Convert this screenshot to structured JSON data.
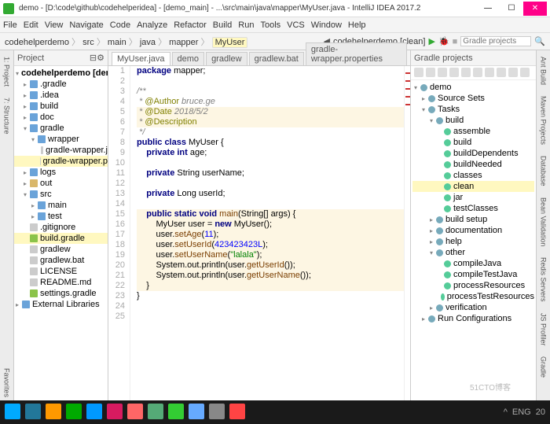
{
  "window": {
    "title": "demo - [D:\\code\\github\\codehelperidea] - [demo_main] - ...\\src\\main\\java\\mapper\\MyUser.java - IntelliJ IDEA 2017.2",
    "min": "—",
    "max": "☐",
    "close": "✕"
  },
  "menu": [
    "File",
    "Edit",
    "View",
    "Navigate",
    "Code",
    "Analyze",
    "Refactor",
    "Build",
    "Run",
    "Tools",
    "VCS",
    "Window",
    "Help"
  ],
  "breadcrumbs": [
    "codehelperdemo",
    "src",
    "main",
    "java",
    "mapper",
    "MyUser"
  ],
  "runconfig": "codehelperdemo [clean]",
  "search": "Gradle projects",
  "project": {
    "header": "Project",
    "nodes": [
      {
        "pad": 0,
        "tw": "▾",
        "ic": "folder",
        "label": "codehelperdemo [demo]",
        "bold": true
      },
      {
        "pad": 10,
        "tw": "▸",
        "ic": "folder",
        "label": ".gradle"
      },
      {
        "pad": 10,
        "tw": "▸",
        "ic": "folder",
        "label": ".idea"
      },
      {
        "pad": 10,
        "tw": "▸",
        "ic": "folder",
        "label": "build"
      },
      {
        "pad": 10,
        "tw": "▸",
        "ic": "folder",
        "label": "doc"
      },
      {
        "pad": 10,
        "tw": "▾",
        "ic": "folder",
        "label": "gradle"
      },
      {
        "pad": 20,
        "tw": "▾",
        "ic": "folder",
        "label": "wrapper"
      },
      {
        "pad": 30,
        "tw": "",
        "ic": "file",
        "label": "gradle-wrapper.j"
      },
      {
        "pad": 30,
        "tw": "",
        "ic": "file",
        "label": "gradle-wrapper.p",
        "sel": true
      },
      {
        "pad": 10,
        "tw": "▸",
        "ic": "folder",
        "label": "logs"
      },
      {
        "pad": 10,
        "tw": "▸",
        "ic": "folder-o",
        "label": "out"
      },
      {
        "pad": 10,
        "tw": "▾",
        "ic": "folder",
        "label": "src"
      },
      {
        "pad": 20,
        "tw": "▸",
        "ic": "folder",
        "label": "main"
      },
      {
        "pad": 20,
        "tw": "▸",
        "ic": "folder",
        "label": "test"
      },
      {
        "pad": 10,
        "tw": "",
        "ic": "file",
        "label": ".gitignore"
      },
      {
        "pad": 10,
        "tw": "",
        "ic": "file-g",
        "label": "build.gradle",
        "sel": true
      },
      {
        "pad": 10,
        "tw": "",
        "ic": "file",
        "label": "gradlew"
      },
      {
        "pad": 10,
        "tw": "",
        "ic": "file",
        "label": "gradlew.bat"
      },
      {
        "pad": 10,
        "tw": "",
        "ic": "file",
        "label": "LICENSE"
      },
      {
        "pad": 10,
        "tw": "",
        "ic": "file",
        "label": "README.md"
      },
      {
        "pad": 10,
        "tw": "",
        "ic": "file-g",
        "label": "settings.gradle"
      },
      {
        "pad": 0,
        "tw": "▸",
        "ic": "folder",
        "label": "External Libraries"
      }
    ]
  },
  "tabs": [
    {
      "label": "MyUser.java",
      "active": true
    },
    {
      "label": "demo"
    },
    {
      "label": "gradlew"
    },
    {
      "label": "gradlew.bat"
    },
    {
      "label": "gradle-wrapper.properties"
    }
  ],
  "code": {
    "start": 1,
    "raw": [
      {
        "t": "<span class='kw'>package</span> mapper;"
      },
      {
        "t": ""
      },
      {
        "t": "<span class='cmt'>/**</span>"
      },
      {
        "t": "<span class='cmt'> * </span><span class='ann'>@Author</span> <span class='cmt'>bruce.ge</span>"
      },
      {
        "t": "<span class='cmt'> * </span><span class='ann'>@Date</span> <span class='cmt'>2018/5/2</span>",
        "hl": true
      },
      {
        "t": "<span class='cmt'> * </span><span class='ann'>@Description</span>",
        "hl": true
      },
      {
        "t": "<span class='cmt'> */</span>"
      },
      {
        "t": "<span class='kw'>public class</span> MyUser {"
      },
      {
        "t": "    <span class='kw'>private int</span> age;"
      },
      {
        "t": ""
      },
      {
        "t": "    <span class='kw'>private</span> String userName;"
      },
      {
        "t": ""
      },
      {
        "t": "    <span class='kw'>private</span> Long userId;"
      },
      {
        "t": ""
      },
      {
        "t": "    <span class='kw'>public static void</span> <span class='mth'>main</span>(String[] args) {",
        "hl": true
      },
      {
        "t": "        MyUser user = <span class='kw'>new</span> MyUser();",
        "hl": true
      },
      {
        "t": "        user.<span class='mth'>setAge</span>(<span class='num'>11</span>);",
        "hl": true
      },
      {
        "t": "        user.<span class='mth'>setUserId</span>(<span class='num'>423423423L</span>);",
        "hl": true
      },
      {
        "t": "        user.<span class='mth'>setUserName</span>(<span class='str'>\"lalala\"</span>);",
        "hl": true
      },
      {
        "t": "        System.out.println(user.<span class='mth'>getUserId</span>());",
        "hl": true
      },
      {
        "t": "        System.out.println(user.<span class='mth'>getUserName</span>());",
        "hl": true
      },
      {
        "t": "    }",
        "hl": true
      },
      {
        "t": "}"
      },
      {
        "t": ""
      },
      {
        "t": ""
      }
    ]
  },
  "gradle": {
    "header": "Gradle projects",
    "nodes": [
      {
        "pad": 0,
        "tw": "▾",
        "ic": "grp",
        "label": "demo"
      },
      {
        "pad": 10,
        "tw": "▸",
        "ic": "grp",
        "label": "Source Sets"
      },
      {
        "pad": 10,
        "tw": "▾",
        "ic": "grp",
        "label": "Tasks"
      },
      {
        "pad": 20,
        "tw": "▾",
        "ic": "grp",
        "label": "build"
      },
      {
        "pad": 30,
        "tw": "",
        "ic": "task",
        "label": "assemble"
      },
      {
        "pad": 30,
        "tw": "",
        "ic": "task",
        "label": "build"
      },
      {
        "pad": 30,
        "tw": "",
        "ic": "task",
        "label": "buildDependents"
      },
      {
        "pad": 30,
        "tw": "",
        "ic": "task",
        "label": "buildNeeded"
      },
      {
        "pad": 30,
        "tw": "",
        "ic": "task",
        "label": "classes"
      },
      {
        "pad": 30,
        "tw": "",
        "ic": "task",
        "label": "clean",
        "sel": true
      },
      {
        "pad": 30,
        "tw": "",
        "ic": "task",
        "label": "jar"
      },
      {
        "pad": 30,
        "tw": "",
        "ic": "task",
        "label": "testClasses"
      },
      {
        "pad": 20,
        "tw": "▸",
        "ic": "grp",
        "label": "build setup"
      },
      {
        "pad": 20,
        "tw": "▸",
        "ic": "grp",
        "label": "documentation"
      },
      {
        "pad": 20,
        "tw": "▸",
        "ic": "grp",
        "label": "help"
      },
      {
        "pad": 20,
        "tw": "▾",
        "ic": "grp",
        "label": "other"
      },
      {
        "pad": 30,
        "tw": "",
        "ic": "task",
        "label": "compileJava"
      },
      {
        "pad": 30,
        "tw": "",
        "ic": "task",
        "label": "compileTestJava"
      },
      {
        "pad": 30,
        "tw": "",
        "ic": "task",
        "label": "processResources"
      },
      {
        "pad": 30,
        "tw": "",
        "ic": "task",
        "label": "processTestResources"
      },
      {
        "pad": 20,
        "tw": "▸",
        "ic": "grp",
        "label": "verification"
      },
      {
        "pad": 10,
        "tw": "▸",
        "ic": "grp",
        "label": "Run Configurations"
      }
    ]
  },
  "leftTabs": [
    "1: Project",
    "7: Structure"
  ],
  "rightTabs": [
    "Ant Build",
    "Maven Projects",
    "Database",
    "Bean Validation",
    "Redis Servers",
    "JS Profiler",
    "Gradle"
  ],
  "bottomLabel": "Favorites",
  "tray": {
    "lang": "ENG",
    "time": "20"
  },
  "watermark": "51CTO博客",
  "taskbarColors": [
    "#0af",
    "#279",
    "#f90",
    "#0a0",
    "#09f",
    "#d81b60",
    "#f66",
    "#5a7",
    "#3c3",
    "#6af",
    "#888",
    "#f44"
  ]
}
